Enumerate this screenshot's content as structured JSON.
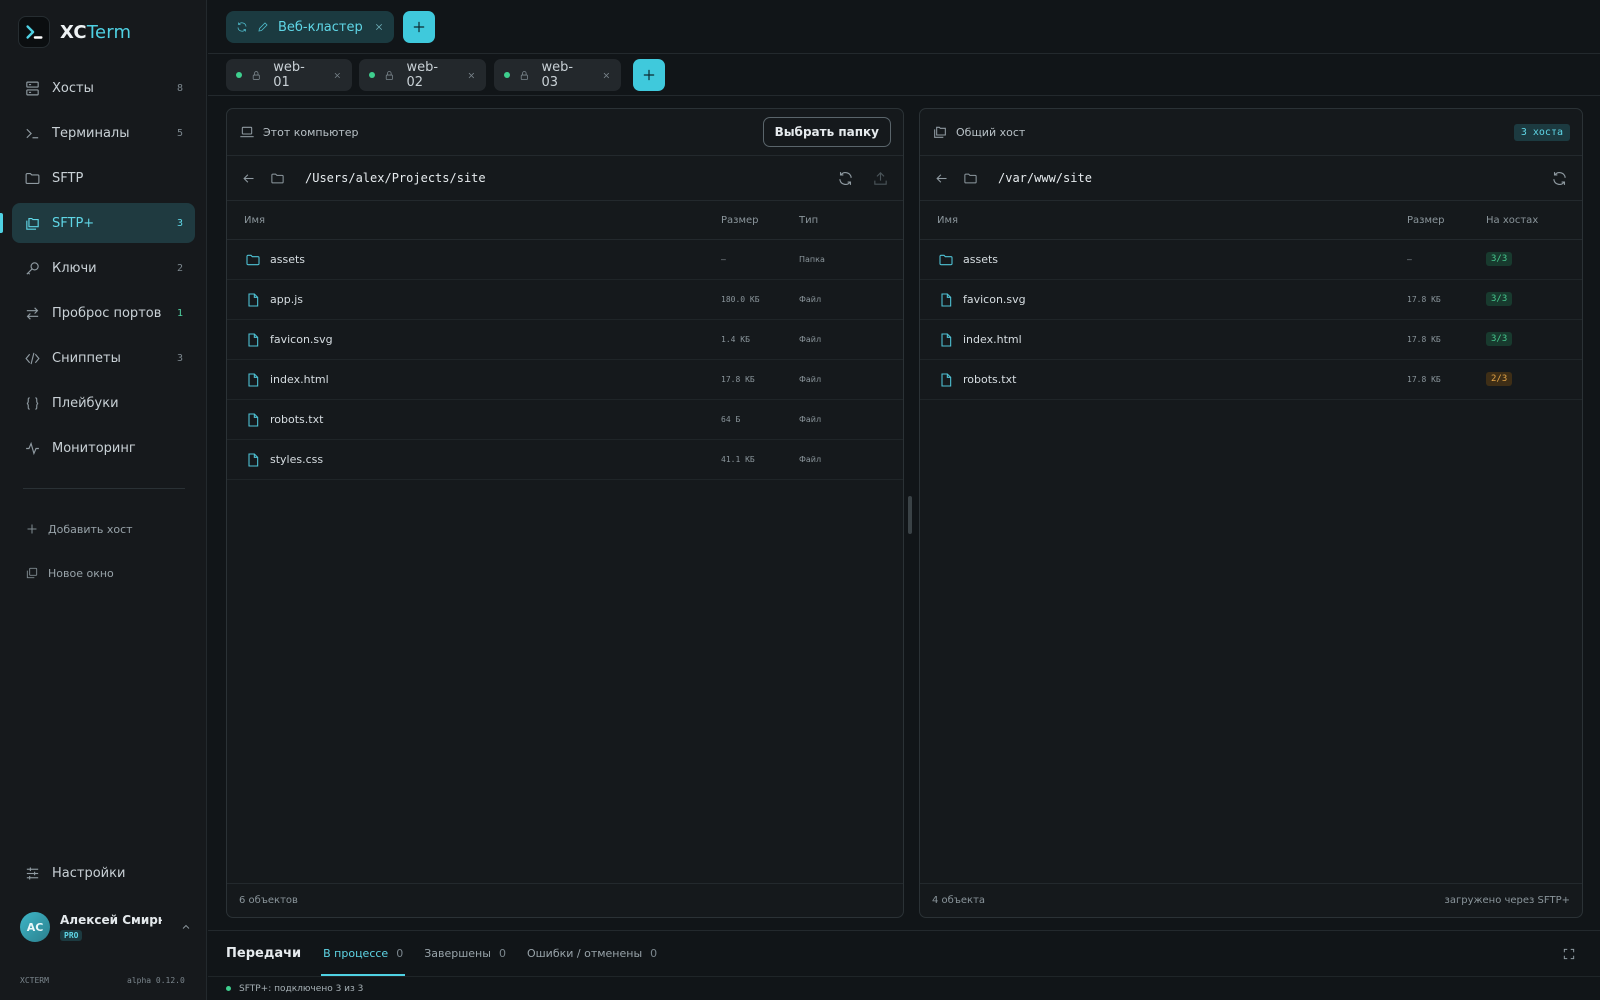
{
  "app": {
    "name_main": "XC",
    "name_accent": "Term"
  },
  "sidebar": {
    "items": [
      {
        "label": "Хосты",
        "count": "8",
        "icon": "server-icon"
      },
      {
        "label": "Терминалы",
        "count": "5",
        "icon": "terminal-icon"
      },
      {
        "label": "SFTP",
        "count": "",
        "icon": "folder-icon"
      },
      {
        "label": "SFTP+",
        "count": "3",
        "icon": "folders-icon",
        "active": true
      },
      {
        "label": "Ключи",
        "count": "2",
        "icon": "key-icon"
      },
      {
        "label": "Проброс портов",
        "count": "1",
        "icon": "arrows-icon"
      },
      {
        "label": "Сниппеты",
        "count": "3",
        "icon": "code-icon"
      },
      {
        "label": "Плейбуки",
        "count": "",
        "icon": "braces-icon"
      },
      {
        "label": "Мониторинг",
        "count": "",
        "icon": "activity-icon"
      }
    ],
    "add_host": "Добавить хост",
    "new_window": "Новое окно",
    "settings": "Настройки",
    "user": {
      "initials": "АС",
      "name": "Алексей Смирн…",
      "plan": "PRO"
    },
    "footer_app": "XCTERM",
    "footer_version": "alpha 0.12.0"
  },
  "group_tab": {
    "label": "Веб-кластер"
  },
  "host_tabs": [
    {
      "label": "web-01"
    },
    {
      "label": "web-02"
    },
    {
      "label": "web-03"
    }
  ],
  "left_panel": {
    "title": "Этот компьютер",
    "choose_button": "Выбрать папку",
    "path": "/Users/alex/Projects/site",
    "columns": {
      "name": "Имя",
      "size": "Размер",
      "type": "Тип"
    },
    "files": [
      {
        "name": "assets",
        "size": "—",
        "type": "Папка",
        "kind": "folder"
      },
      {
        "name": "app.js",
        "size": "180.0 КБ",
        "type": "Файл",
        "kind": "file"
      },
      {
        "name": "favicon.svg",
        "size": "1.4 КБ",
        "type": "Файл",
        "kind": "file"
      },
      {
        "name": "index.html",
        "size": "17.8 КБ",
        "type": "Файл",
        "kind": "file"
      },
      {
        "name": "robots.txt",
        "size": "64 Б",
        "type": "Файл",
        "kind": "file"
      },
      {
        "name": "styles.css",
        "size": "41.1 КБ",
        "type": "Файл",
        "kind": "file"
      }
    ],
    "footer": "6 объектов"
  },
  "right_panel": {
    "title": "Общий хост",
    "hosts_badge": "3 хоста",
    "path": "/var/www/site",
    "columns": {
      "name": "Имя",
      "size": "Размер",
      "hosts": "На хостах"
    },
    "files": [
      {
        "name": "assets",
        "size": "—",
        "hosts": "3/3",
        "kind": "folder",
        "status": "ok"
      },
      {
        "name": "favicon.svg",
        "size": "17.8 КБ",
        "hosts": "3/3",
        "kind": "file",
        "status": "ok"
      },
      {
        "name": "index.html",
        "size": "17.8 КБ",
        "hosts": "3/3",
        "kind": "file",
        "status": "ok"
      },
      {
        "name": "robots.txt",
        "size": "17.8 КБ",
        "hosts": "2/3",
        "kind": "file",
        "status": "warn"
      }
    ],
    "footer_left": "4 объекта",
    "footer_right": "загружено через SFTP+"
  },
  "transfers": {
    "title": "Передачи",
    "tabs": [
      {
        "label": "В процессе",
        "count": "0",
        "active": true
      },
      {
        "label": "Завершены",
        "count": "0"
      },
      {
        "label": "Ошибки / отменены",
        "count": "0"
      }
    ]
  },
  "status": {
    "text": "SFTP+: подключено 3 из 3"
  },
  "colors": {
    "accent": "#4fd1e3",
    "ok": "#46c98e",
    "warn": "#e3a447",
    "background": "#111518"
  }
}
